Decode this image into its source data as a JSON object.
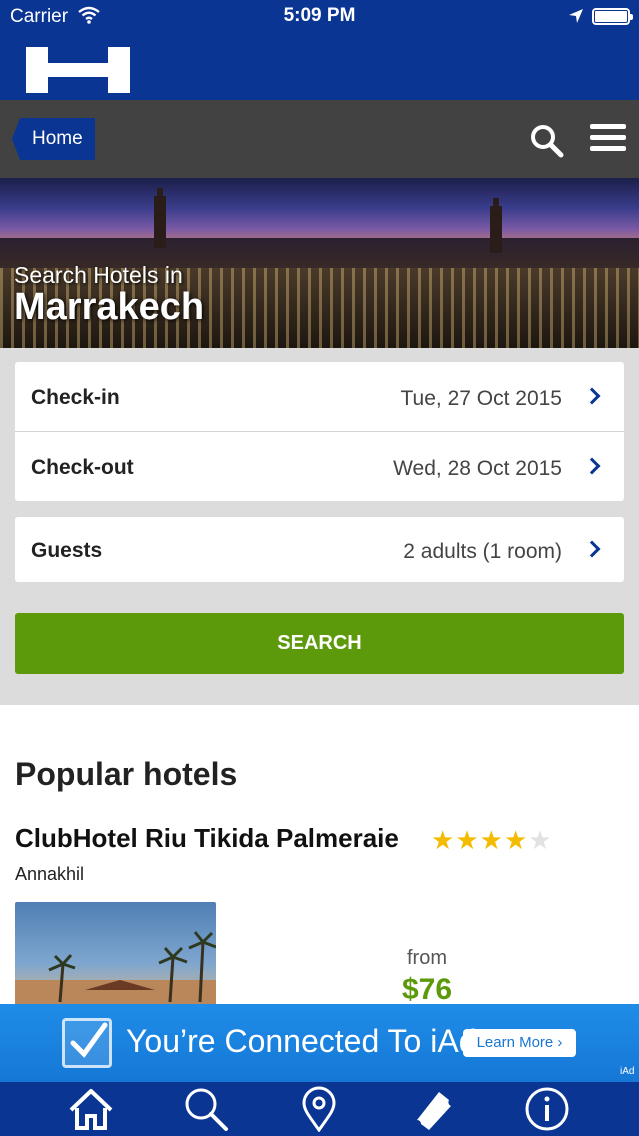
{
  "status_bar": {
    "carrier": "Carrier",
    "time": "5:09 PM"
  },
  "nav": {
    "home_label": "Home"
  },
  "hero": {
    "subtitle": "Search Hotels in",
    "city": "Marrakech"
  },
  "form": {
    "checkin_label": "Check-in",
    "checkin_value": "Tue, 27 Oct 2015",
    "checkout_label": "Check-out",
    "checkout_value": "Wed, 28 Oct 2015",
    "guests_label": "Guests",
    "guests_value": "2 adults (1 room)",
    "search_button": "SEARCH"
  },
  "popular": {
    "title": "Popular hotels",
    "hotels": [
      {
        "name": "ClubHotel Riu Tikida Palmeraie",
        "stars": 4,
        "max_stars": 5,
        "area": "Annakhil",
        "price_prefix": "from",
        "price": "$76"
      }
    ]
  },
  "ad": {
    "text": "You’re Connected To iAd",
    "button": "Learn More ›",
    "tag": "iAd"
  },
  "tabs": [
    {
      "icon": "home-icon"
    },
    {
      "icon": "search-icon"
    },
    {
      "icon": "location-pin-icon"
    },
    {
      "icon": "ticket-icon"
    },
    {
      "icon": "info-icon"
    }
  ],
  "colors": {
    "brand_blue": "#0a3593",
    "search_green": "#5c9a0b",
    "star_gold": "#f4bc00",
    "nav_gray": "#424242"
  }
}
